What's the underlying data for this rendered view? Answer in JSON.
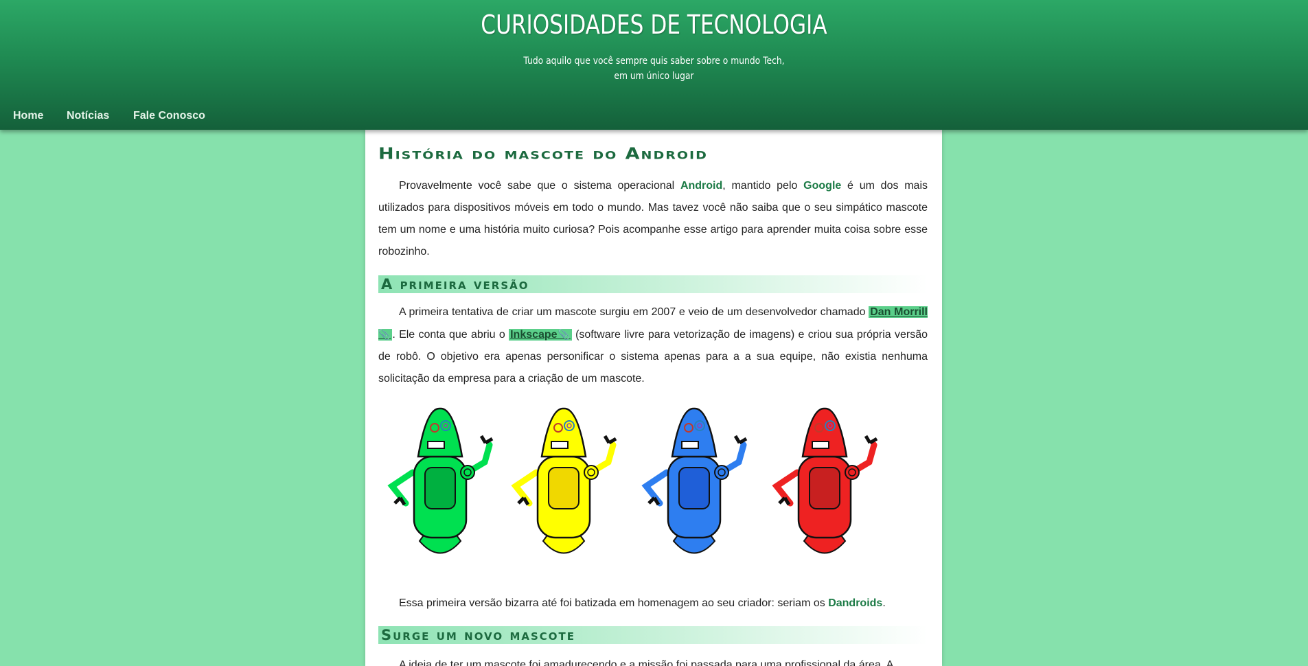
{
  "header": {
    "title": "CURIOSIDADES DE TECNOLOGIA",
    "subtitle_line1": "Tudo aquilo que você sempre quis saber sobre o mundo Tech,",
    "subtitle_line2": "em um único lugar"
  },
  "nav": {
    "items": [
      {
        "label": "Home"
      },
      {
        "label": "Notícias"
      },
      {
        "label": "Fale Conosco"
      }
    ]
  },
  "article": {
    "title": "História do mascote do Android",
    "p1": {
      "t1": "Provavelmente você sabe que o sistema operacional ",
      "k1": "Android",
      "t2": ", mantido pelo ",
      "k2": "Google",
      "t3": " é um dos mais utilizados para dispositivos móveis em todo o mundo. Mas tavez você não saiba que o seu simpático mascote tem um nome e uma história muito curiosa? Pois acompanhe esse artigo para aprender muita coisa sobre esse robozinho."
    },
    "section1_title": "A primeira versão",
    "p2": {
      "t1": "A primeira tentativa de criar um mascote surgiu em 2007 e veio de um desenvolvedor chamado ",
      "link1": "Dan Morrill",
      "t2": ". Ele conta que abriu o ",
      "link2": "Inkscape",
      "t3": " (software livre para vetorização de imagens) e criou sua própria versão de robô. O objetivo era apenas personificar o sistema apenas para a a sua equipe, não existia nenhuma solicitação da empresa para a criação de um mascote."
    },
    "link_icon": "paperclip-icon",
    "robots": [
      {
        "color": "#00e050",
        "dark": "#00b040"
      },
      {
        "color": "#ffff00",
        "dark": "#f0d800"
      },
      {
        "color": "#2e7ef0",
        "dark": "#1f5fd8"
      },
      {
        "color": "#ee2222",
        "dark": "#c82020"
      }
    ],
    "p3": {
      "t1": "Essa primeira versão bizarra até foi batizada em homenagem ao seu criador: seriam os ",
      "k1": "Dandroids",
      "t2": "."
    },
    "section2_title": "Surge um novo mascote",
    "p4": {
      "t1": "A ideia de ter um mascote foi amadurecendo e a missão foi passada para uma profissional da área. A"
    }
  },
  "colors": {
    "background": "#86e1ac",
    "header_top": "#2ca866",
    "header_bottom": "#14603a",
    "accent": "#1b7a45",
    "highlight": "#5bcf8a"
  }
}
